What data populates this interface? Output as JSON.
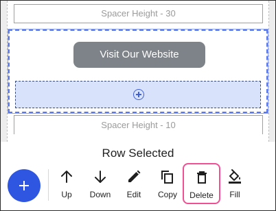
{
  "canvas": {
    "spacer_top_label": "Spacer Height - 30",
    "spacer_bottom_label": "Spacer Height - 10",
    "button_label": "Visit Our Website"
  },
  "sheet": {
    "title": "Row Selected",
    "tools": [
      {
        "label": "Up",
        "icon": "arrow-up-icon"
      },
      {
        "label": "Down",
        "icon": "arrow-down-icon"
      },
      {
        "label": "Edit",
        "icon": "pencil-icon"
      },
      {
        "label": "Copy",
        "icon": "copy-icon"
      },
      {
        "label": "Delete",
        "icon": "trash-icon"
      },
      {
        "label": "Fill",
        "icon": "paint-bucket-icon"
      }
    ],
    "fab_icon": "plus-icon"
  },
  "colors": {
    "accent": "#2f56e0",
    "selection_border": "#5b78e8",
    "highlight_border": "#ef4f93",
    "button_bg": "#7d8388"
  }
}
